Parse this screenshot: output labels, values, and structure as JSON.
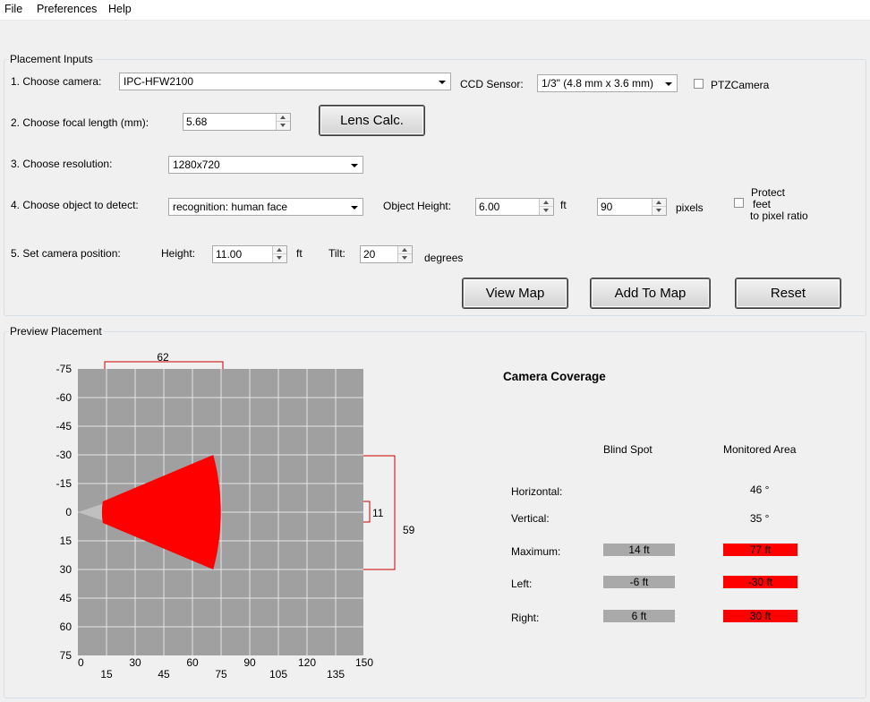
{
  "menu": {
    "items": [
      "File",
      "Preferences",
      "Help"
    ]
  },
  "placement_inputs": {
    "title": "Placement Inputs",
    "choose_camera_label": "1. Choose camera:",
    "camera_value": "IPC-HFW2100",
    "ccd_sensor_label": "CCD Sensor:",
    "ccd_sensor_value": "1/3\" (4.8 mm x 3.6 mm)",
    "ptz_label": "PTZCamera",
    "focal_length_label": "2. Choose focal length (mm):",
    "focal_length_value": "5.68",
    "lens_calc_label": "Lens Calc.",
    "resolution_label": "3. Choose resolution:",
    "resolution_value": "1280x720",
    "object_label": "4. Choose object to detect:",
    "object_value": "recognition: human face",
    "object_height_label": "Object Height:",
    "object_height_value": "6.00",
    "object_height_unit": "ft",
    "pixels_value": "90",
    "pixels_unit": "pixels",
    "protect_line1": "Protect",
    "protect_line2": "feet",
    "protect_line3": "to pixel ratio",
    "camera_position_label": "5. Set camera position:",
    "height_label": "Height:",
    "height_value": "11.00",
    "height_unit": "ft",
    "tilt_label": "Tilt:",
    "tilt_value": "20",
    "tilt_unit": "degrees",
    "view_map_label": "View Map",
    "add_to_map_label": "Add To Map",
    "reset_label": "Reset"
  },
  "preview": {
    "title": "Preview Placement",
    "y_ticks": [
      "-75",
      "-60",
      "-45",
      "-30",
      "-15",
      "0",
      "15",
      "30",
      "45",
      "60",
      "75"
    ],
    "x_ticks_top": [
      "0",
      "30",
      "60",
      "90",
      "120",
      "150"
    ],
    "x_ticks_bottom": [
      "15",
      "45",
      "75",
      "105",
      "135"
    ],
    "dim_top": "62",
    "dim_right_small": "11",
    "dim_right_large": "59",
    "colors": {
      "grid_bg": "#a0a0a0",
      "coverage": "#ff0000",
      "blind": "#c0c0c0"
    },
    "coverage": {
      "blind_spot_ft": 14,
      "max_range_ft": 77,
      "half_width_ft": 30
    }
  },
  "coverage": {
    "title": "Camera Coverage",
    "col_blind": "Blind Spot",
    "col_monitored": "Monitored Area",
    "horizontal_label": "Horizontal:",
    "horizontal_value": "46 °",
    "vertical_label": "Vertical:",
    "vertical_value": "35 °",
    "maximum_label": "Maximum:",
    "maximum_blind": "14 ft",
    "maximum_monitored": "77 ft",
    "left_label": "Left:",
    "left_blind": "-6 ft",
    "left_monitored": "-30 ft",
    "right_label": "Right:",
    "right_blind": "6 ft",
    "right_monitored": "30 ft"
  }
}
